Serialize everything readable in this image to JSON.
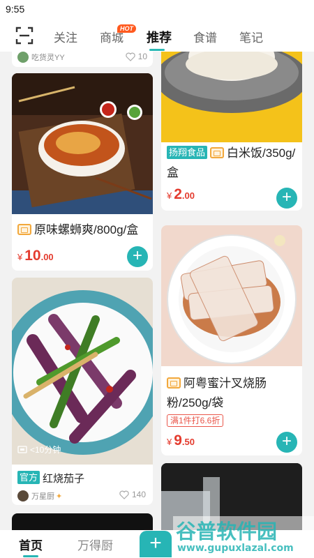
{
  "status_bar": {
    "time": "9:55"
  },
  "top_nav": {
    "tabs": [
      {
        "label": "关注"
      },
      {
        "label": "商城",
        "badge": "HOT"
      },
      {
        "label": "推荐",
        "active": true
      },
      {
        "label": "食谱"
      },
      {
        "label": "笔记"
      }
    ],
    "scan_icon": "scan-icon"
  },
  "feed": {
    "left_column": [
      {
        "author": "吃货灵YY",
        "likes": "10"
      },
      {
        "title": "原味螺蛳爽/800g/盒",
        "price_symbol": "¥",
        "price_int": "10",
        "price_dec": ".00",
        "image_icon": "snail-noodle-bowl"
      },
      {
        "duration": "<10分钟",
        "brand_tag": "官方",
        "title": "红烧茄子",
        "author": "万星厨",
        "likes": "140",
        "image_icon": "braised-eggplant-dish"
      }
    ],
    "right_column": [
      {
        "brand_tag": "扬翔食品",
        "title": "白米饭/350g/盒",
        "price_symbol": "¥",
        "price_int": "2",
        "price_dec": ".00",
        "image_icon": "white-rice-plate"
      },
      {
        "title": "阿粤蜜汁叉烧肠粉/250g/袋",
        "promo": "满1件打6.6折",
        "price_symbol": "¥",
        "price_int": "9",
        "price_dec": ".50",
        "image_icon": "rice-noodle-roll-plate"
      }
    ]
  },
  "bottom_nav": {
    "items": [
      {
        "label": "首页",
        "active": true
      },
      {
        "label": "万得厨"
      }
    ],
    "fab_label": "+"
  },
  "watermark": {
    "text": "谷普软件园",
    "url_text": "www.gupuxlazal.com"
  },
  "colors": {
    "accent": "#27b5b5",
    "price": "#e43b2e",
    "hot": "#ff5a1f"
  }
}
